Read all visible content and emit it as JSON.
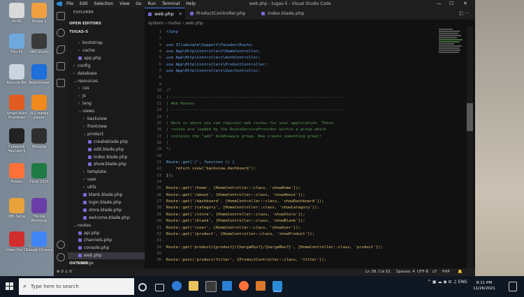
{
  "desktop": {
    "icons": [
      {
        "label": "ACER",
        "color": "#d9d9d9"
      },
      {
        "label": "Picasa 3",
        "color": "#f0a040"
      },
      {
        "label": "This PC",
        "color": "#6fa8dc"
      },
      {
        "label": "OBS Studio",
        "color": "#3a3a3a"
      },
      {
        "label": "Recycle Bin",
        "color": "#c9d4de"
      },
      {
        "label": "TeamViewer",
        "color": "#1e6fd9"
      },
      {
        "label": "Smart Auto Shutdown",
        "color": "#e15b20"
      },
      {
        "label": "VLC media player",
        "color": "#f08a1c"
      },
      {
        "label": "Cyberlink YouCam 5",
        "color": "#222222"
      },
      {
        "label": "Winamp",
        "color": "#2f2f2f"
      },
      {
        "label": "Firefox",
        "color": "#ff7139"
      },
      {
        "label": "Excel 2016",
        "color": "#1f7a44"
      },
      {
        "label": "OBS Setup",
        "color": "#e9a23b"
      },
      {
        "label": "Tik-tok Bombing",
        "color": "#6a3ea6"
      },
      {
        "label": "Video Pro 10",
        "color": "#d22e2e"
      },
      {
        "label": "Google Chrome",
        "color": "#4285f4"
      }
    ]
  },
  "window": {
    "title": "web.php - tugas-5 - Visual Studio Code",
    "menu": [
      "File",
      "Edit",
      "Selection",
      "View",
      "Go",
      "Run",
      "Terminal",
      "Help"
    ],
    "controls": {
      "min": "—",
      "max": "☐",
      "close": "✕"
    }
  },
  "sidebar": {
    "explorer_label": "EXPLORER",
    "open_editors": "OPEN EDITORS",
    "project": "TUGAS-5",
    "outline": "OUTLINE",
    "tree": [
      {
        "label": "bootstrap",
        "type": "folder",
        "depth": 1
      },
      {
        "label": "cache",
        "type": "folder",
        "depth": 1
      },
      {
        "label": "app.php",
        "type": "file",
        "depth": 1
      },
      {
        "label": "config",
        "type": "folder",
        "depth": 0
      },
      {
        "label": "database",
        "type": "folder",
        "depth": 0
      },
      {
        "label": "resources",
        "type": "folder-open",
        "depth": 0
      },
      {
        "label": "css",
        "type": "folder",
        "depth": 1
      },
      {
        "label": "js",
        "type": "folder",
        "depth": 1
      },
      {
        "label": "lang",
        "type": "folder",
        "depth": 1
      },
      {
        "label": "views",
        "type": "folder-open",
        "depth": 1
      },
      {
        "label": "backview",
        "type": "folder",
        "depth": 2
      },
      {
        "label": "frontview",
        "type": "folder",
        "depth": 2
      },
      {
        "label": "product",
        "type": "folder-open",
        "depth": 2
      },
      {
        "label": "createblade.php",
        "type": "file",
        "depth": 3
      },
      {
        "label": "edit.blade.php",
        "type": "file",
        "depth": 3
      },
      {
        "label": "index.blade.php",
        "type": "file",
        "depth": 3
      },
      {
        "label": "show.blade.php",
        "type": "file",
        "depth": 3
      },
      {
        "label": "template",
        "type": "folder",
        "depth": 2
      },
      {
        "label": "user",
        "type": "folder",
        "depth": 2
      },
      {
        "label": "utils",
        "type": "folder",
        "depth": 2
      },
      {
        "label": "blank.blade.php",
        "type": "file",
        "depth": 2
      },
      {
        "label": "login.blade.php",
        "type": "file",
        "depth": 2
      },
      {
        "label": "store.blade.php",
        "type": "file",
        "depth": 2
      },
      {
        "label": "welcome.blade.php",
        "type": "file",
        "depth": 2
      },
      {
        "label": "routes",
        "type": "folder-open",
        "depth": 0
      },
      {
        "label": "api.php",
        "type": "file",
        "depth": 1
      },
      {
        "label": "channels.php",
        "type": "file",
        "depth": 1
      },
      {
        "label": "console.php",
        "type": "file",
        "depth": 1
      },
      {
        "label": "web.php",
        "type": "file",
        "depth": 1,
        "selected": true
      },
      {
        "label": "storage",
        "type": "folder",
        "depth": 0
      }
    ]
  },
  "tabs": [
    {
      "label": "web.php",
      "active": true
    },
    {
      "label": "ProductController.php",
      "active": false
    },
    {
      "label": "index.blade.php",
      "active": false
    }
  ],
  "breadcrumb": [
    "system",
    "routes",
    "web.php"
  ],
  "code": [
    {
      "n": "1",
      "t": "<?php",
      "c": "#5d9cf6"
    },
    {
      "n": "2",
      "t": "",
      "c": "#cfcfcf"
    },
    {
      "n": "3",
      "t": "use Illuminate\\Support\\Facades\\Route;",
      "c": "#69a7f0"
    },
    {
      "n": "4",
      "t": "use App\\Http\\Controllers\\HomeController;",
      "c": "#69a7f0"
    },
    {
      "n": "5",
      "t": "use App\\Http\\Controllers\\AuthController;",
      "c": "#69a7f0"
    },
    {
      "n": "6",
      "t": "use App\\Http\\Controllers\\ProductController;",
      "c": "#69a7f0"
    },
    {
      "n": "7",
      "t": "use App\\Http\\Controllers\\UserController;",
      "c": "#69a7f0"
    },
    {
      "n": "8",
      "t": "",
      "c": "#cfcfcf"
    },
    {
      "n": "9",
      "t": "",
      "c": "#cfcfcf"
    },
    {
      "n": "10",
      "t": "/*",
      "c": "#5a9955"
    },
    {
      "n": "11",
      "t": "|--------------------------------------------------------------------------",
      "c": "#5a9955"
    },
    {
      "n": "12",
      "t": "| Web Routes",
      "c": "#5a9955"
    },
    {
      "n": "13",
      "t": "|--------------------------------------------------------------------------",
      "c": "#5a9955"
    },
    {
      "n": "14",
      "t": "|",
      "c": "#5a9955"
    },
    {
      "n": "15",
      "t": "| Here is where you can register web routes for your application. These",
      "c": "#5a9955"
    },
    {
      "n": "16",
      "t": "| routes are loaded by the RouteServiceProvider within a group which",
      "c": "#5a9955"
    },
    {
      "n": "17",
      "t": "| contains the \"web\" middleware group. Now create something great!",
      "c": "#5a9955"
    },
    {
      "n": "18",
      "t": "|",
      "c": "#5a9955"
    },
    {
      "n": "19",
      "t": "*/",
      "c": "#5a9955"
    },
    {
      "n": "20",
      "t": "",
      "c": "#cfcfcf"
    },
    {
      "n": "21",
      "t": "Route::get('/', function () {",
      "c": "#6ab0e8"
    },
    {
      "n": "22",
      "t": "    return view('backview.dashboard');",
      "c": "#e0c070"
    },
    {
      "n": "23",
      "t": "});",
      "c": "#cfcfcf"
    },
    {
      "n": "24",
      "t": "",
      "c": "#cfcfcf"
    },
    {
      "n": "25",
      "t": "Route::get('/home', [HomeController::class, 'showHome']);",
      "c": "#e0c070"
    },
    {
      "n": "26",
      "t": "Route::get('/about', [HomeController::class, 'showAbout']);",
      "c": "#e0c070"
    },
    {
      "n": "27",
      "t": "Route::get('/dashboard', [HomeController::class, 'showDashboard']);",
      "c": "#e0c070"
    },
    {
      "n": "28",
      "t": "Route::get('/category', [HomeController::class, 'showCategory']);",
      "c": "#e0c070"
    },
    {
      "n": "29",
      "t": "Route::get('/store', [HomeController::class, 'showStore']);",
      "c": "#e0c070"
    },
    {
      "n": "30",
      "t": "Route::get('/blank', [HomeController::class, 'showBlank']);",
      "c": "#e0c070"
    },
    {
      "n": "31",
      "t": "Route::get('/user', [HomeController::class, 'showUser']);",
      "c": "#e0c070"
    },
    {
      "n": "32",
      "t": "Route::get('/product', [HomeController::class, 'showProduct']);",
      "c": "#e0c070"
    },
    {
      "n": "33",
      "t": "",
      "c": "#cfcfcf"
    },
    {
      "n": "34",
      "t": "Route::get('product/{product}/{hargaMin?}/{hargaMax?}', [HomeController::class, 'product']);",
      "c": "#e0c070"
    },
    {
      "n": "35",
      "t": "",
      "c": "#cfcfcf"
    },
    {
      "n": "36",
      "t": "Route::post('product/filter', [ProductController::class, 'filter']);",
      "c": "#e0c070"
    }
  ],
  "status": {
    "left": "⊗ 0 ⚠ 0",
    "position": "Ln 38, Col 61",
    "spaces": "Spaces: 4",
    "encoding": "UTF-8",
    "eol": "LF",
    "lang": "PHP"
  },
  "taskbar": {
    "search_placeholder": "Type here to search",
    "time": "8:11 PM",
    "date": "11/26/2021"
  }
}
